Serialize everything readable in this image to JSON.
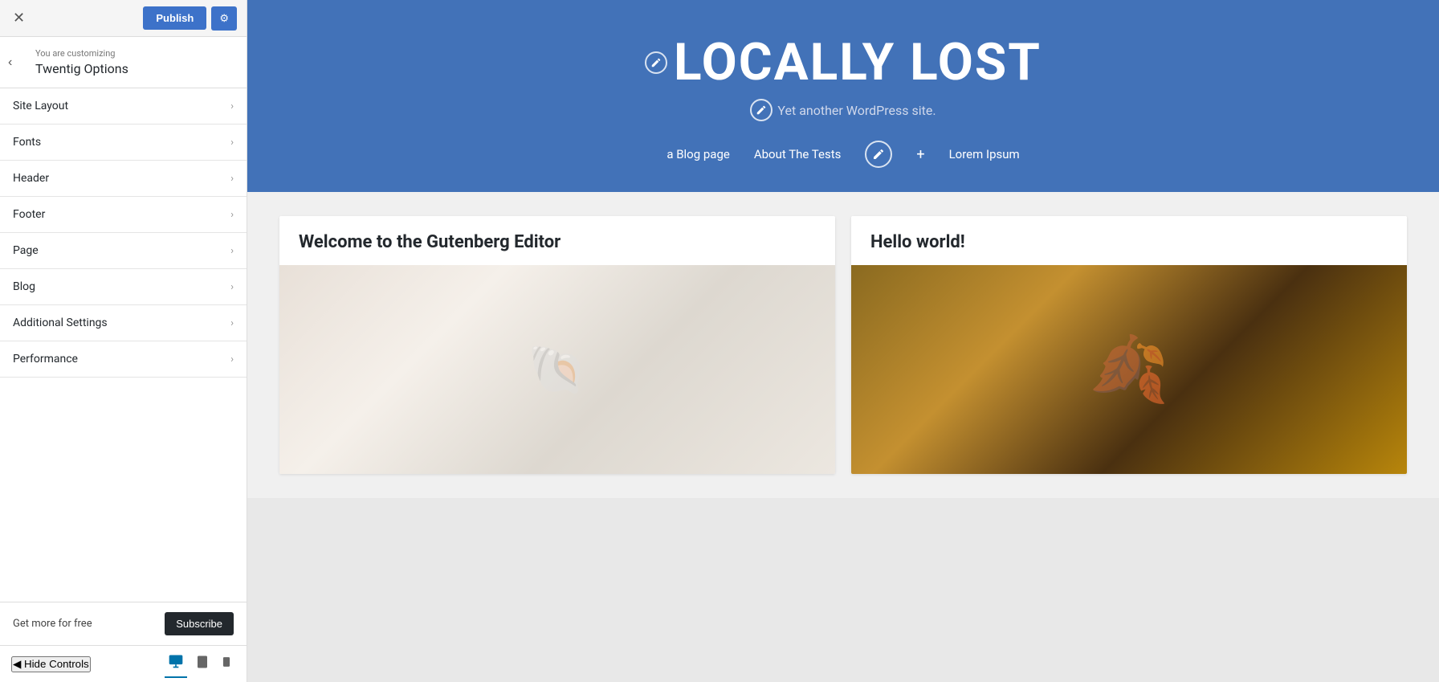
{
  "topbar": {
    "close_label": "✕",
    "publish_label": "Publish",
    "settings_label": "⚙"
  },
  "customizer": {
    "customizing_text": "You are customizing",
    "theme_name": "Twentig Options",
    "back_icon": "‹"
  },
  "menu": {
    "items": [
      {
        "label": "Site Layout"
      },
      {
        "label": "Fonts"
      },
      {
        "label": "Header"
      },
      {
        "label": "Footer"
      },
      {
        "label": "Page"
      },
      {
        "label": "Blog"
      },
      {
        "label": "Additional Settings"
      },
      {
        "label": "Performance"
      }
    ]
  },
  "bottom": {
    "get_more_text": "Get more for free",
    "subscribe_label": "Subscribe"
  },
  "footer_controls": {
    "hide_controls_label": "Hide Controls",
    "hide_icon": "◀"
  },
  "site": {
    "title": "LOCALLY LOST",
    "description": "Yet another WordPress site.",
    "nav_items": [
      "a Blog page",
      "About The Tests",
      "+",
      "Lorem Ipsum"
    ]
  },
  "posts": [
    {
      "title": "Welcome to the Gutenberg Editor"
    },
    {
      "title": "Hello world!"
    }
  ]
}
